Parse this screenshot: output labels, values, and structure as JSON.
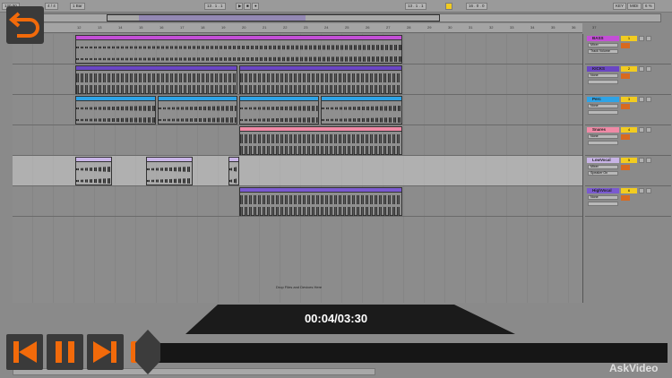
{
  "toolbar": {
    "tempo": "120.00",
    "signature": "4 / 4",
    "quantize": "1 Bar",
    "position": "13 . 1 . 1",
    "loop_start": "13 . 1 . 1",
    "loop_length": "16 . 0 . 0",
    "key": "KEY",
    "midi": "MIDI",
    "cpu": "6 %"
  },
  "ruler": {
    "bars": [
      "12",
      "13",
      "14",
      "15",
      "16",
      "17",
      "18",
      "19",
      "20",
      "21",
      "22",
      "23",
      "24",
      "25",
      "26",
      "27",
      "28",
      "29",
      "30",
      "31",
      "32",
      "33",
      "34",
      "35",
      "36",
      "37"
    ]
  },
  "tracks": [
    {
      "name": "BASS",
      "color": "#c34fd6",
      "number": "1",
      "input": "Mixer",
      "param": "Track Volume"
    },
    {
      "name": "KICKS",
      "color": "#6a46c4",
      "number": "2",
      "input": "None",
      "param": ""
    },
    {
      "name": "Perc",
      "color": "#2ea3e6",
      "number": "3",
      "input": "None",
      "param": ""
    },
    {
      "name": "Snares",
      "color": "#f08aa6",
      "number": "4",
      "input": "None",
      "param": ""
    },
    {
      "name": "LowVocal",
      "color": "#c8b4e6",
      "number": "5",
      "input": "Mixer",
      "param": "Speaker On"
    },
    {
      "name": "HighVocal",
      "color": "#7a5ad0",
      "number": "6",
      "input": "None",
      "param": ""
    }
  ],
  "arrangement": {
    "drop_text": "Drop Files and Devices Here"
  },
  "player": {
    "time": "00:04/03:30",
    "progress_fraction": 0.019,
    "accent": "#f26a0a",
    "logo": "AskVideo"
  }
}
